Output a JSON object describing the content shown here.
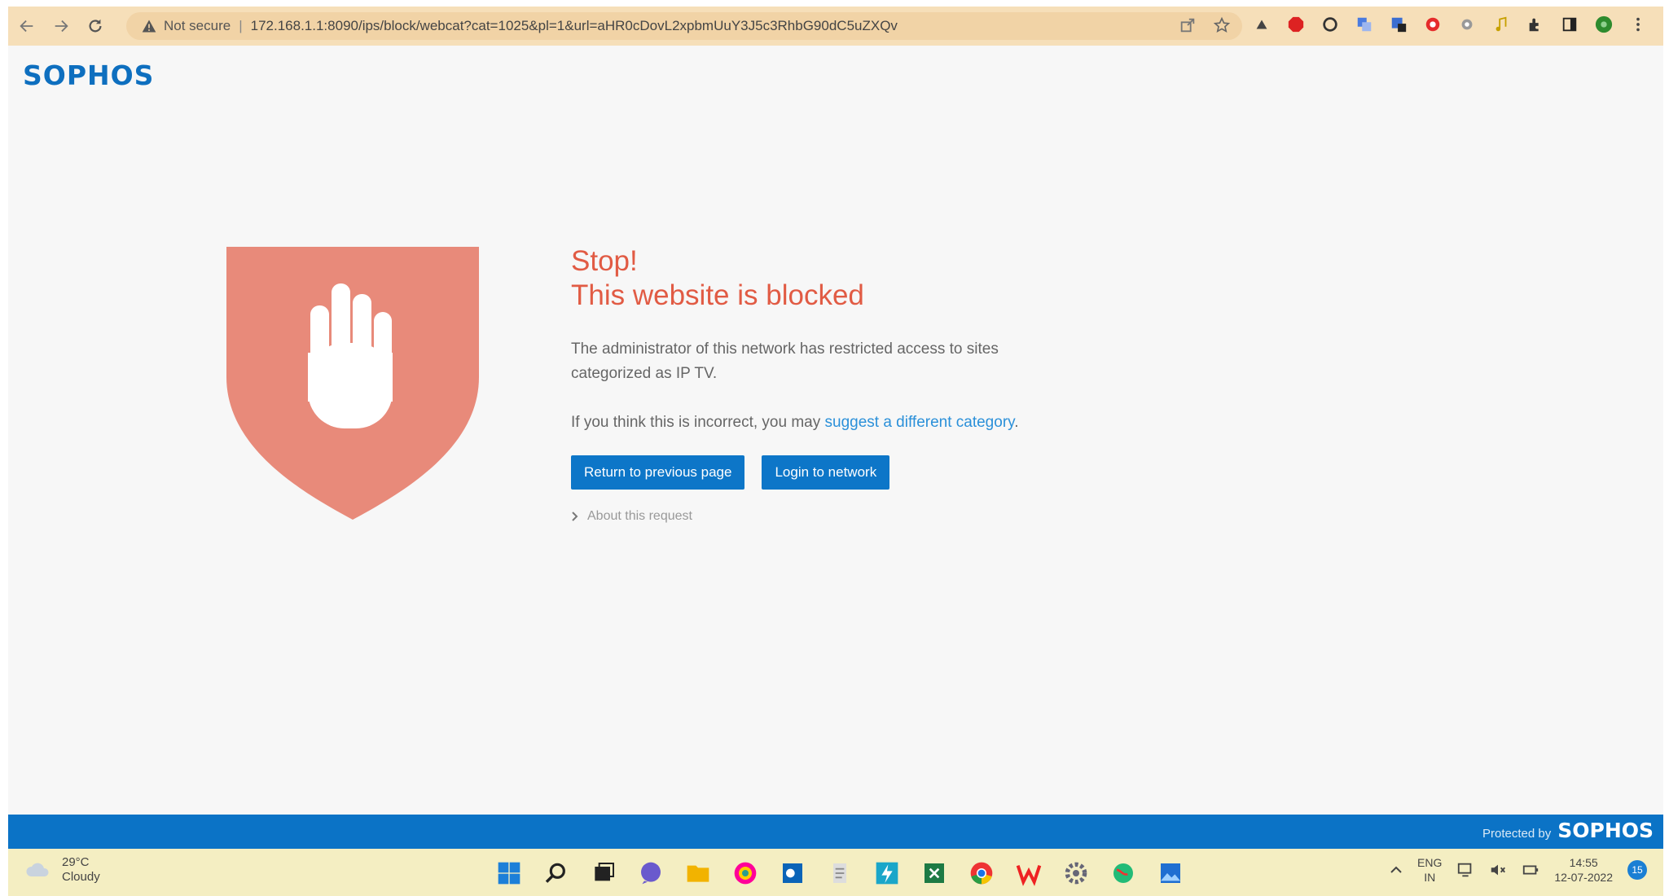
{
  "browser": {
    "not_secure_label": "Not secure",
    "separator": "|",
    "url": "172.168.1.1:8090/ips/block/webcat?cat=1025&pl=1&url=aHR0cDovL2xpbmUuY3J5c3RhbG90dC5uZXQv"
  },
  "page": {
    "logo": "SOPHOS",
    "title_line1": "Stop!",
    "title_line2": "This website is blocked",
    "description": "The administrator of this network has restricted access to sites categorized as IP TV.",
    "suggest_prefix": "If you think this is incorrect, you may ",
    "suggest_link": "suggest a different category",
    "suggest_suffix": ".",
    "return_button": "Return to previous page",
    "login_button": "Login to network",
    "about_link": "About this request"
  },
  "footer": {
    "protected_by": "Protected by",
    "brand": "SOPHOS"
  },
  "taskbar": {
    "temperature": "29°C",
    "condition": "Cloudy",
    "lang_line1": "ENG",
    "lang_line2": "IN",
    "time": "14:55",
    "date": "12-07-2022",
    "notification_count": "15"
  },
  "colors": {
    "accent": "#0b73c6",
    "alert": "#e15b44",
    "shield": "#e88a7a",
    "link": "#2b90d9"
  }
}
